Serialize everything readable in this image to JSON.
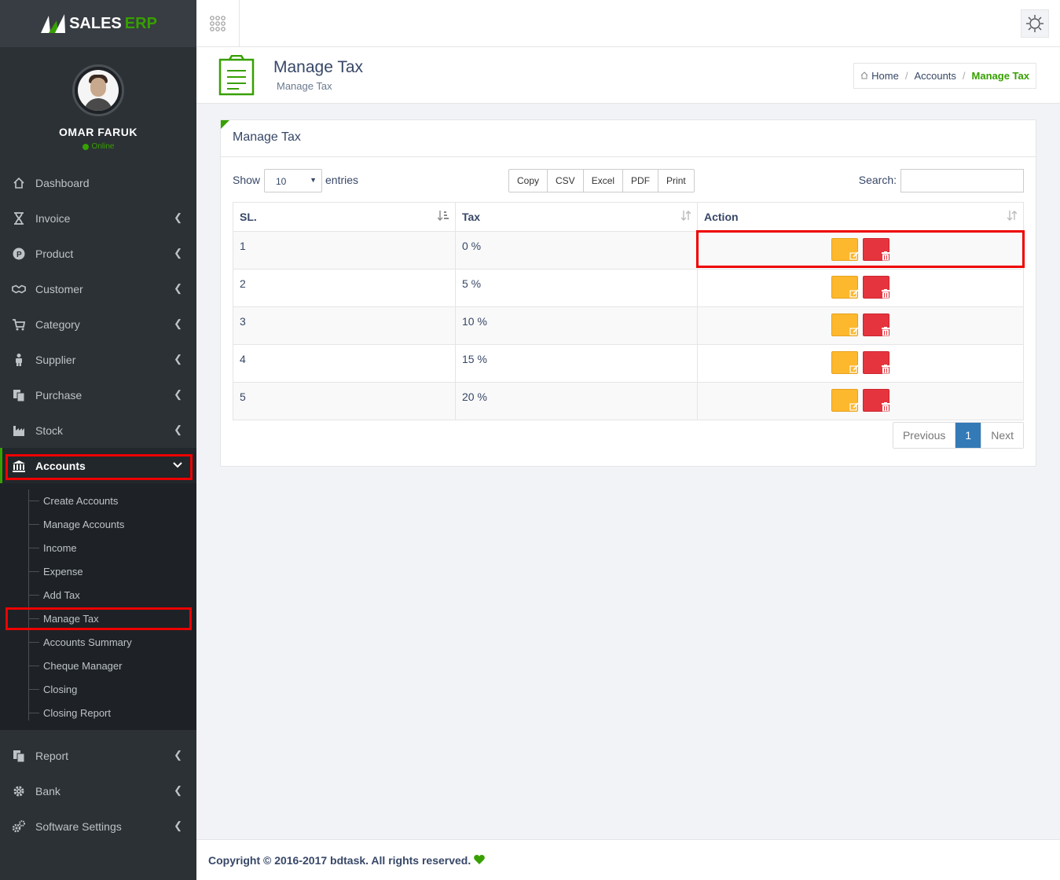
{
  "brand": {
    "name_part1": "SALES",
    "name_part2": "ERP",
    "accent_color": "#37a000"
  },
  "user": {
    "name": "OMAR FARUK",
    "status": "Online"
  },
  "sidebar": {
    "items": [
      {
        "label": "Dashboard",
        "icon": "home-icon"
      },
      {
        "label": "Invoice",
        "icon": "hourglass-icon"
      },
      {
        "label": "Product",
        "icon": "product-p-icon"
      },
      {
        "label": "Customer",
        "icon": "handshake-icon"
      },
      {
        "label": "Category",
        "icon": "cart-icon"
      },
      {
        "label": "Supplier",
        "icon": "person-icon"
      },
      {
        "label": "Purchase",
        "icon": "copy-icon"
      },
      {
        "label": "Stock",
        "icon": "industry-icon"
      },
      {
        "label": "Accounts",
        "icon": "bank-icon"
      }
    ],
    "accounts_submenu": [
      "Create Accounts",
      "Manage Accounts",
      "Income",
      "Expense",
      "Add Tax",
      "Manage Tax",
      "Accounts Summary",
      "Cheque Manager",
      "Closing",
      "Closing Report"
    ],
    "bottom_items": [
      {
        "label": "Report",
        "icon": "copy-icon"
      },
      {
        "label": "Bank",
        "icon": "gear-icon"
      },
      {
        "label": "Software Settings",
        "icon": "gears-icon"
      }
    ]
  },
  "page_header": {
    "title": "Manage Tax",
    "subtitle": "Manage Tax"
  },
  "breadcrumb": {
    "home": "Home",
    "accounts": "Accounts",
    "current": "Manage Tax"
  },
  "panel": {
    "title": "Manage Tax",
    "show_label": "Show",
    "entries_selected": "10",
    "entries_label": "entries",
    "export_buttons": [
      "Copy",
      "CSV",
      "Excel",
      "PDF",
      "Print"
    ],
    "search_label": "Search:"
  },
  "table": {
    "headers": [
      "SL.",
      "Tax",
      "Action"
    ],
    "rows": [
      {
        "sl": "1",
        "tax": "0 %"
      },
      {
        "sl": "2",
        "tax": "5 %"
      },
      {
        "sl": "3",
        "tax": "10 %"
      },
      {
        "sl": "4",
        "tax": "15 %"
      },
      {
        "sl": "5",
        "tax": "20 %"
      }
    ]
  },
  "pagination": {
    "previous": "Previous",
    "current": "1",
    "next": "Next"
  },
  "footer": {
    "text": "Copyright © 2016-2017 bdtask. All rights reserved."
  },
  "colors": {
    "edit": "#fdb82e",
    "delete": "#e5343d",
    "pager_active": "#337ab7",
    "sidebar_bg": "#2c3136"
  }
}
